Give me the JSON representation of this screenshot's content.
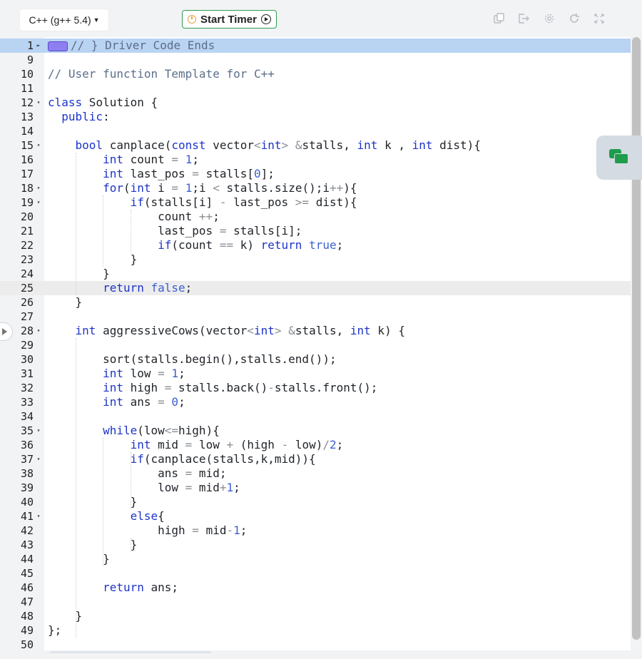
{
  "toolbar": {
    "language": "C++ (g++ 5.4)",
    "start_timer": "Start Timer",
    "icons": [
      "copy-icon",
      "export-icon",
      "settings-icon",
      "reset-icon",
      "fullscreen-icon"
    ]
  },
  "editor": {
    "highlighted_line": "1",
    "current_line": "25",
    "lines": [
      {
        "n": "1",
        "fold": "►",
        "html": "<span class=\"badge\"></span><span class=\"c\">// } Driver Code Ends</span>"
      },
      {
        "n": "9",
        "fold": "",
        "html": ""
      },
      {
        "n": "10",
        "fold": "",
        "html": "<span class=\"c\">// User function Template for C++</span>"
      },
      {
        "n": "11",
        "fold": "",
        "html": ""
      },
      {
        "n": "12",
        "fold": "▾",
        "html": "<span class=\"k\">class</span> Solution {"
      },
      {
        "n": "13",
        "fold": "",
        "html": "  <span class=\"k\">public</span>:"
      },
      {
        "n": "14",
        "fold": "",
        "html": ""
      },
      {
        "n": "15",
        "fold": "▾",
        "html": "    <span class=\"k\">bool</span> canplace(<span class=\"k\">const</span> vector<span class=\"o\">&lt;</span><span class=\"k\">int</span><span class=\"o\">&gt;</span> <span class=\"o\">&amp;</span>stalls, <span class=\"k\">int</span> k , <span class=\"k\">int</span> dist){"
      },
      {
        "n": "16",
        "fold": "",
        "html": "        <span class=\"k\">int</span> count <span class=\"o\">=</span> <span class=\"b\">1</span>;"
      },
      {
        "n": "17",
        "fold": "",
        "html": "        <span class=\"k\">int</span> last_pos <span class=\"o\">=</span> stalls[<span class=\"b\">0</span>];"
      },
      {
        "n": "18",
        "fold": "▾",
        "html": "        <span class=\"k\">for</span>(<span class=\"k\">int</span> i <span class=\"o\">=</span> <span class=\"b\">1</span>;i <span class=\"o\">&lt;</span> stalls.size();i<span class=\"o\">++</span>){"
      },
      {
        "n": "19",
        "fold": "▾",
        "html": "            <span class=\"k\">if</span>(stalls[i] <span class=\"o\">-</span> last_pos <span class=\"o\">&gt;=</span> dist){"
      },
      {
        "n": "20",
        "fold": "",
        "html": "                count <span class=\"o\">++</span>;"
      },
      {
        "n": "21",
        "fold": "",
        "html": "                last_pos <span class=\"o\">=</span> stalls[i];"
      },
      {
        "n": "22",
        "fold": "",
        "html": "                <span class=\"k\">if</span>(count <span class=\"o\">==</span> k) <span class=\"k\">return</span> <span class=\"b\">true</span>;"
      },
      {
        "n": "23",
        "fold": "",
        "html": "            }"
      },
      {
        "n": "24",
        "fold": "",
        "html": "        }"
      },
      {
        "n": "25",
        "fold": "",
        "html": "        <span class=\"k\">return</span> <span class=\"b\">false</span>;"
      },
      {
        "n": "26",
        "fold": "",
        "html": "    }"
      },
      {
        "n": "27",
        "fold": "",
        "html": ""
      },
      {
        "n": "28",
        "fold": "▾",
        "html": "    <span class=\"k\">int</span> aggressiveCows(vector<span class=\"o\">&lt;</span><span class=\"k\">int</span><span class=\"o\">&gt;</span> <span class=\"o\">&amp;</span>stalls, <span class=\"k\">int</span> k) {"
      },
      {
        "n": "29",
        "fold": "",
        "html": ""
      },
      {
        "n": "30",
        "fold": "",
        "html": "        sort(stalls.begin(),stalls.end());"
      },
      {
        "n": "31",
        "fold": "",
        "html": "        <span class=\"k\">int</span> low <span class=\"o\">=</span> <span class=\"b\">1</span>;"
      },
      {
        "n": "32",
        "fold": "",
        "html": "        <span class=\"k\">int</span> high <span class=\"o\">=</span> stalls.back()<span class=\"o\">-</span>stalls.front();"
      },
      {
        "n": "33",
        "fold": "",
        "html": "        <span class=\"k\">int</span> ans <span class=\"o\">=</span> <span class=\"b\">0</span>;"
      },
      {
        "n": "34",
        "fold": "",
        "html": ""
      },
      {
        "n": "35",
        "fold": "▾",
        "html": "        <span class=\"k\">while</span>(low<span class=\"o\">&lt;=</span>high){"
      },
      {
        "n": "36",
        "fold": "",
        "html": "            <span class=\"k\">int</span> mid <span class=\"o\">=</span> low <span class=\"o\">+</span> (high <span class=\"o\">-</span> low)<span class=\"o\">/</span><span class=\"b\">2</span>;"
      },
      {
        "n": "37",
        "fold": "▾",
        "html": "            <span class=\"k\">if</span>(canplace(stalls,k,mid)){"
      },
      {
        "n": "38",
        "fold": "",
        "html": "                ans <span class=\"o\">=</span> mid;"
      },
      {
        "n": "39",
        "fold": "",
        "html": "                low <span class=\"o\">=</span> mid<span class=\"o\">+</span><span class=\"b\">1</span>;"
      },
      {
        "n": "40",
        "fold": "",
        "html": "            }"
      },
      {
        "n": "41",
        "fold": "▾",
        "html": "            <span class=\"k\">else</span>{"
      },
      {
        "n": "42",
        "fold": "",
        "html": "                high <span class=\"o\">=</span> mid<span class=\"o\">-</span><span class=\"b\">1</span>;"
      },
      {
        "n": "43",
        "fold": "",
        "html": "            }"
      },
      {
        "n": "44",
        "fold": "",
        "html": "        }"
      },
      {
        "n": "45",
        "fold": "",
        "html": ""
      },
      {
        "n": "46",
        "fold": "",
        "html": "        <span class=\"k\">return</span> ans;"
      },
      {
        "n": "47",
        "fold": "",
        "html": ""
      },
      {
        "n": "48",
        "fold": "",
        "html": "    }"
      },
      {
        "n": "49",
        "fold": "",
        "html": "};"
      },
      {
        "n": "50",
        "fold": "",
        "html": ""
      }
    ]
  },
  "colors": {
    "keyword": "#1d34c8",
    "comment": "#5b6f8a",
    "accent_green": "#2e9e4f",
    "highlight_line": "#b9d3f3"
  }
}
